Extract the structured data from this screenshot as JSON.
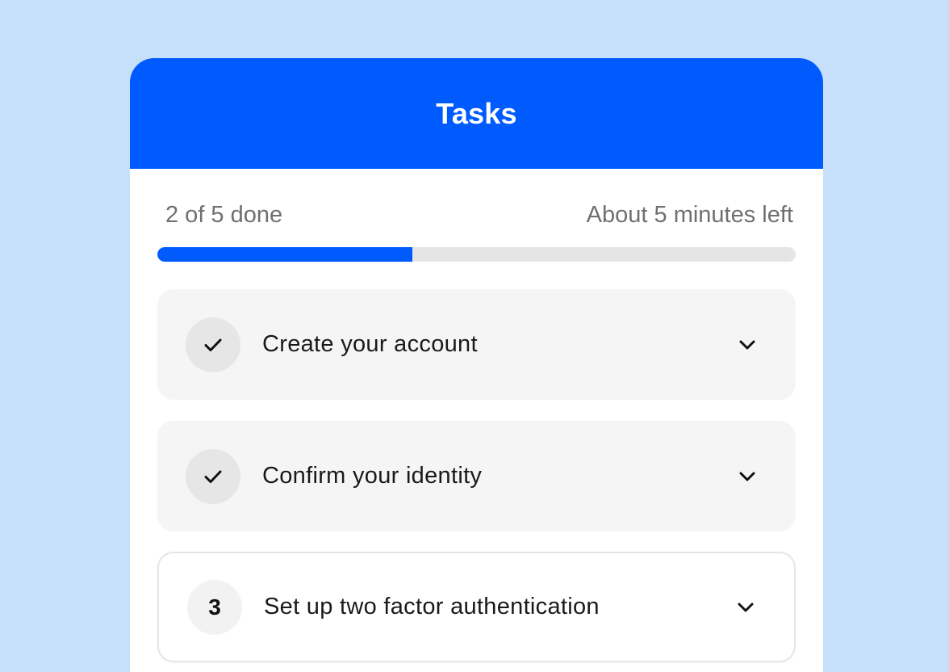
{
  "header": {
    "title": "Tasks"
  },
  "progress": {
    "done_text": "2 of 5 done",
    "remaining_text": "About 5 minutes left",
    "completed": 2,
    "total": 5,
    "fraction": 0.4
  },
  "tasks": [
    {
      "label": "Create your account",
      "status": "done",
      "icon": "checkmark-icon"
    },
    {
      "label": "Confirm your identity",
      "status": "done",
      "icon": "checkmark-icon"
    },
    {
      "label": "Set up two factor authentication",
      "status": "current",
      "number": "3"
    }
  ],
  "colors": {
    "background": "#C6DFFB",
    "accent": "#005BFF",
    "track": "#E5E5E5",
    "done_row": "#F5F5F5"
  }
}
